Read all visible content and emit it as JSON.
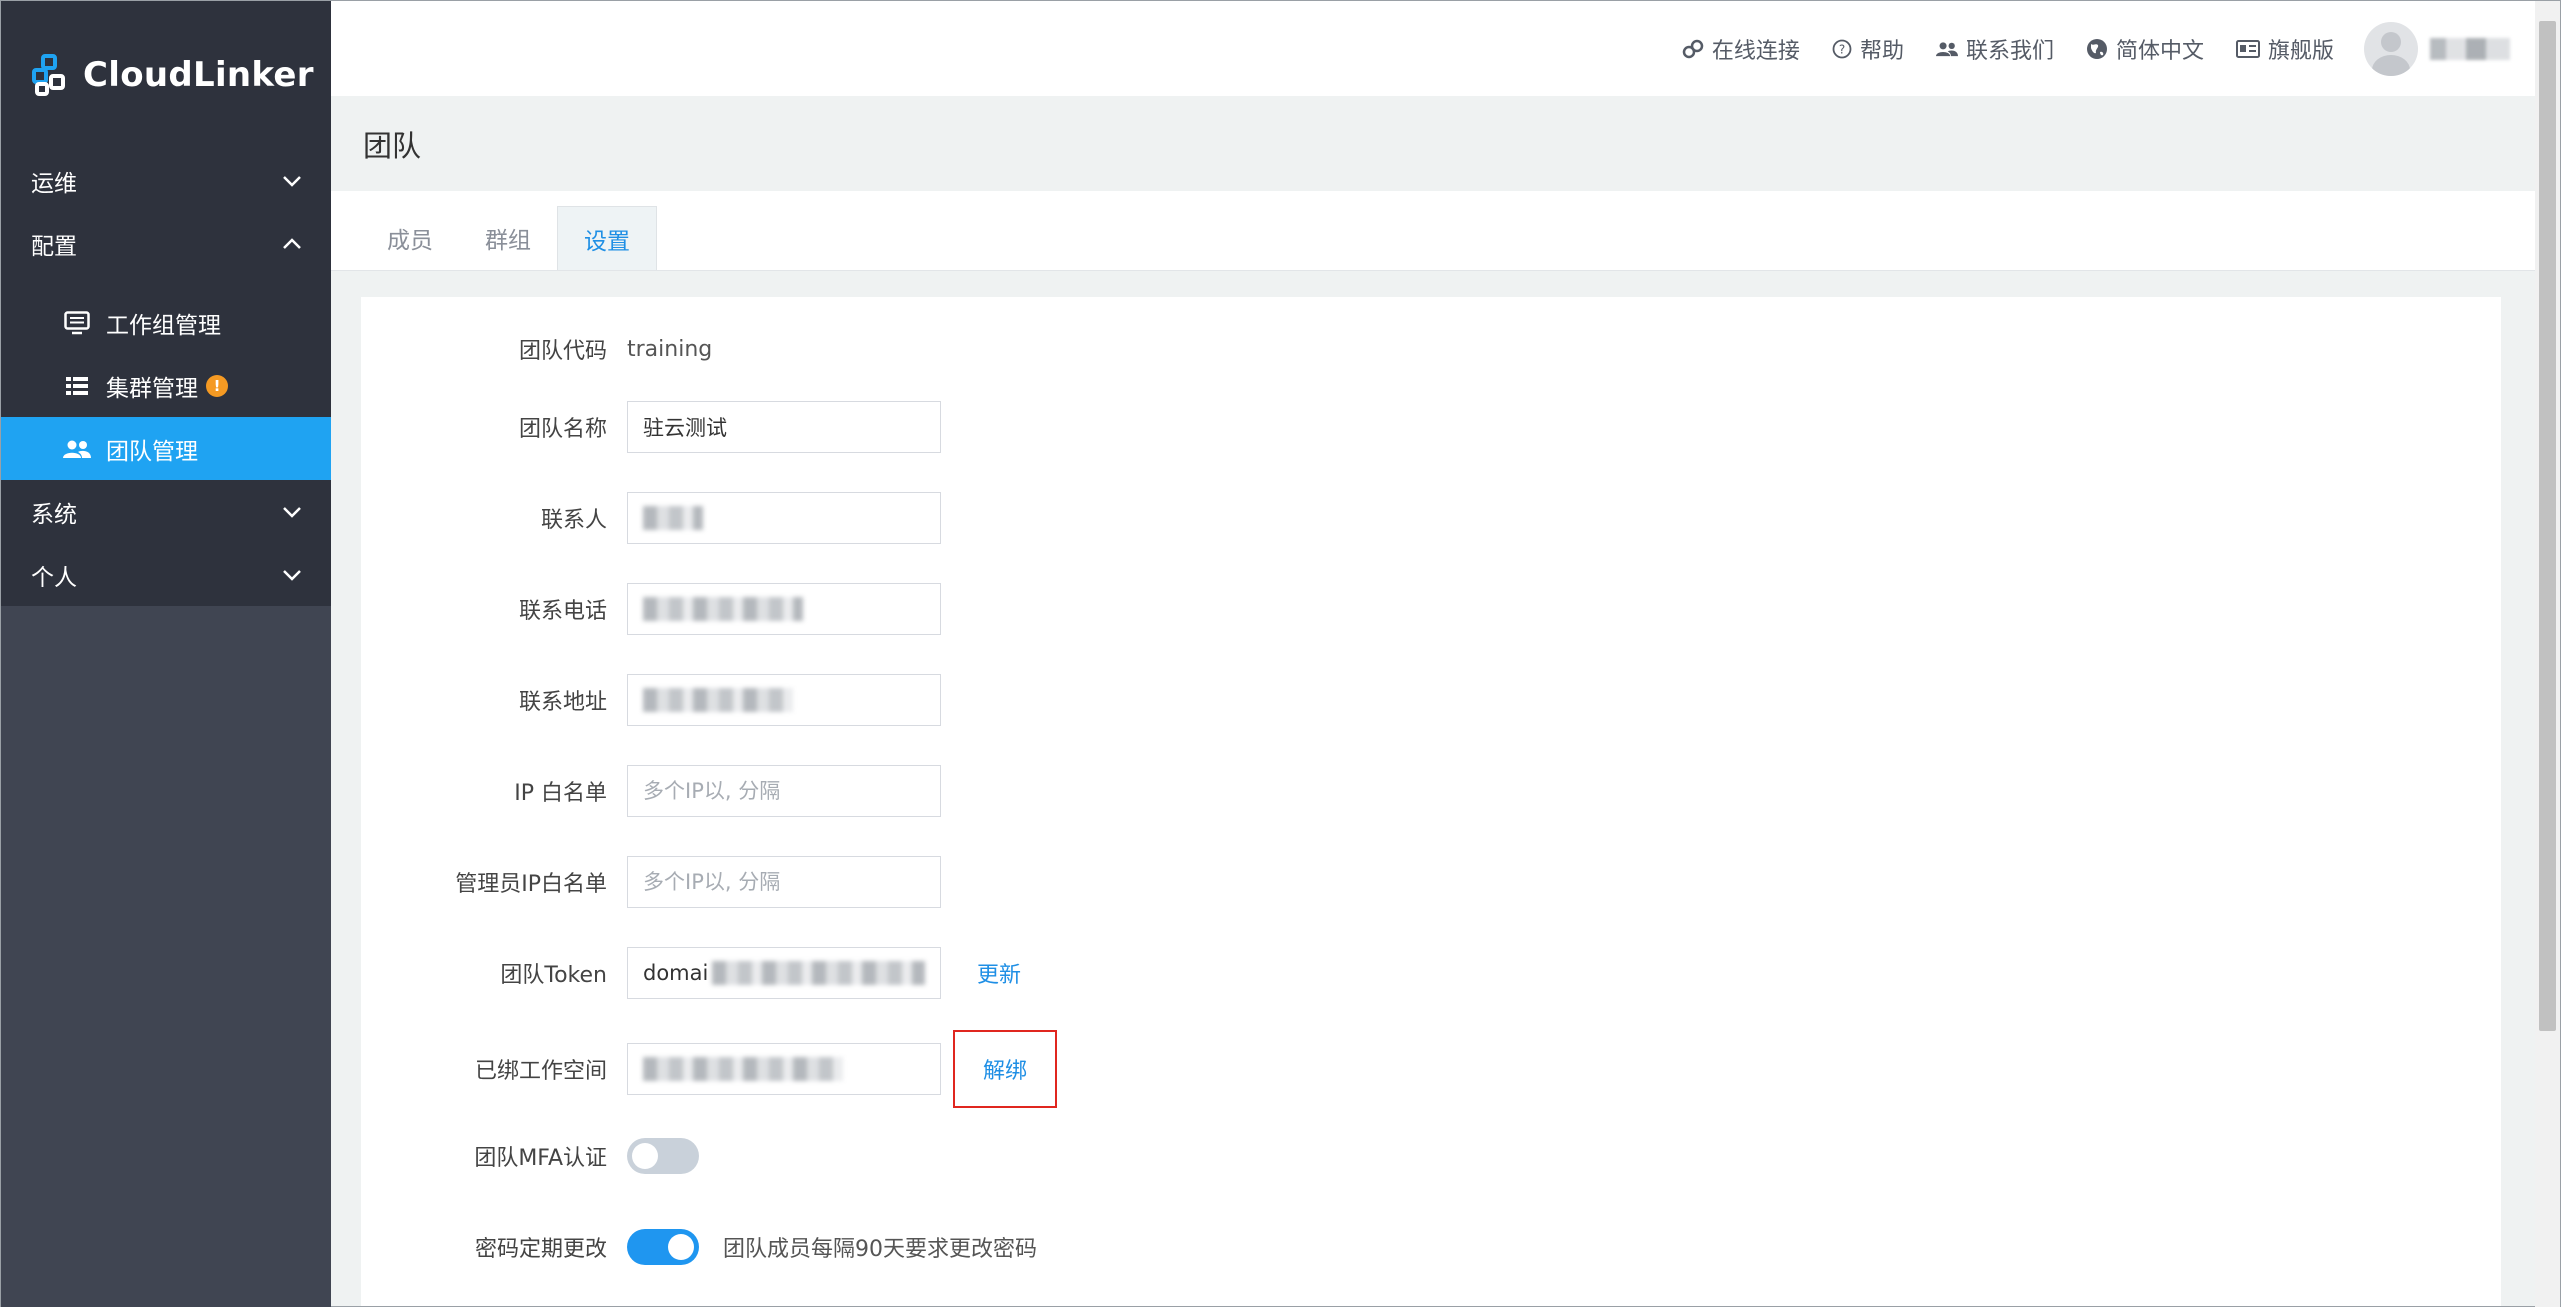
{
  "app": {
    "logo_text": "CloudLinker"
  },
  "sidebar": {
    "groups": [
      {
        "label": "运维"
      },
      {
        "label": "配置"
      },
      {
        "label": "系统"
      },
      {
        "label": "个人"
      }
    ],
    "config_items": [
      {
        "label": "工作组管理",
        "icon": "monitor-list-icon"
      },
      {
        "label": "集群管理",
        "icon": "list-icon",
        "badge": "!"
      },
      {
        "label": "团队管理",
        "icon": "people-icon"
      }
    ]
  },
  "topbar": {
    "online": "在线连接",
    "help": "帮助",
    "contact": "联系我们",
    "language": "简体中文",
    "edition": "旗舰版"
  },
  "page": {
    "title": "团队",
    "tabs": [
      "成员",
      "群组",
      "设置"
    ]
  },
  "form": {
    "team_code_label": "团队代码",
    "team_code_value": "training",
    "team_name_label": "团队名称",
    "team_name_value": "驻云测试",
    "contact_label": "联系人",
    "phone_label": "联系电话",
    "address_label": "联系地址",
    "ip_whitelist_label": "IP 白名单",
    "ip_whitelist_placeholder": "多个IP以, 分隔",
    "admin_ip_label": "管理员IP白名单",
    "admin_ip_placeholder": "多个IP以, 分隔",
    "token_label": "团队Token",
    "token_prefix": "domai",
    "token_refresh": "更新",
    "workspace_label": "已绑工作空间",
    "workspace_unbind": "解绑",
    "mfa_label": "团队MFA认证",
    "mfa_enabled": false,
    "pwd_label": "密码定期更改",
    "pwd_enabled": true,
    "pwd_hint": "团队成员每隔90天要求更改密码"
  },
  "colors": {
    "accent": "#1f96f0",
    "sidebar_bg": "#404552",
    "sidebar_dark": "#2e323d",
    "active_item": "#1fa3f2",
    "highlight_border": "#e0261f"
  }
}
